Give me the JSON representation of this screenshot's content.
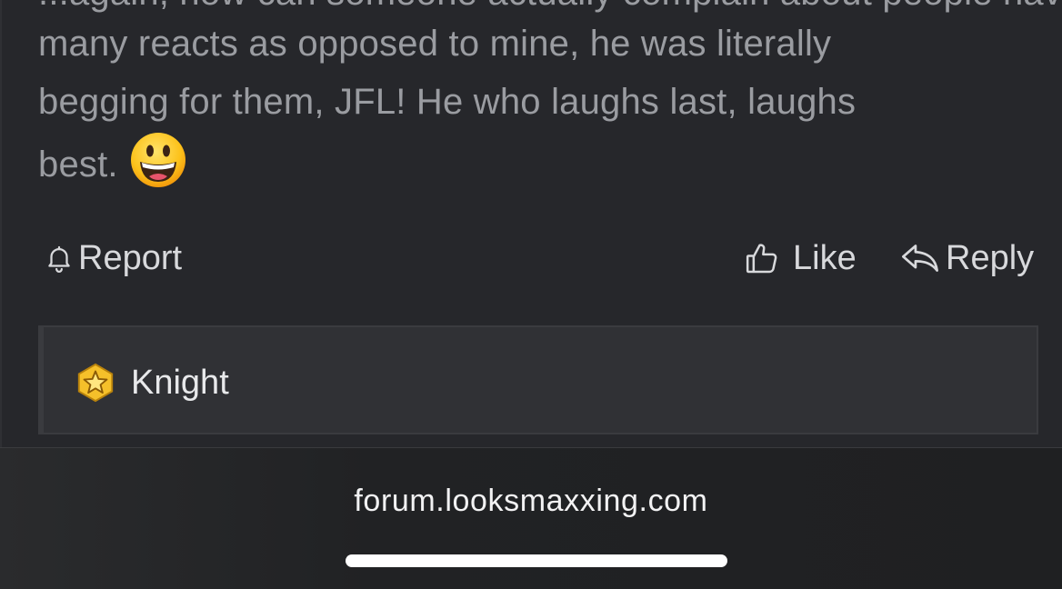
{
  "post": {
    "partial_top_line": "...again, how can someone actually complain about people having",
    "body_lines": [
      "many reacts as opposed to mine, he was literally",
      "begging for them, JFL! He who laughs last, laughs",
      "best."
    ],
    "emoji_icon": "grinning-face-emoji"
  },
  "actions": {
    "report_label": "Report",
    "like_label": "Like",
    "reply_label": "Reply"
  },
  "signature": {
    "badge_icon": "star-badge-icon",
    "label": "Knight"
  },
  "browser": {
    "url": "forum.looksmaxxing.com"
  },
  "colors": {
    "post_bg": "#26272b",
    "body_text": "#9a9ca1",
    "action_text": "#d8d9dc",
    "signature_bg": "#303135",
    "badge_yellow": "#f5c02a"
  }
}
